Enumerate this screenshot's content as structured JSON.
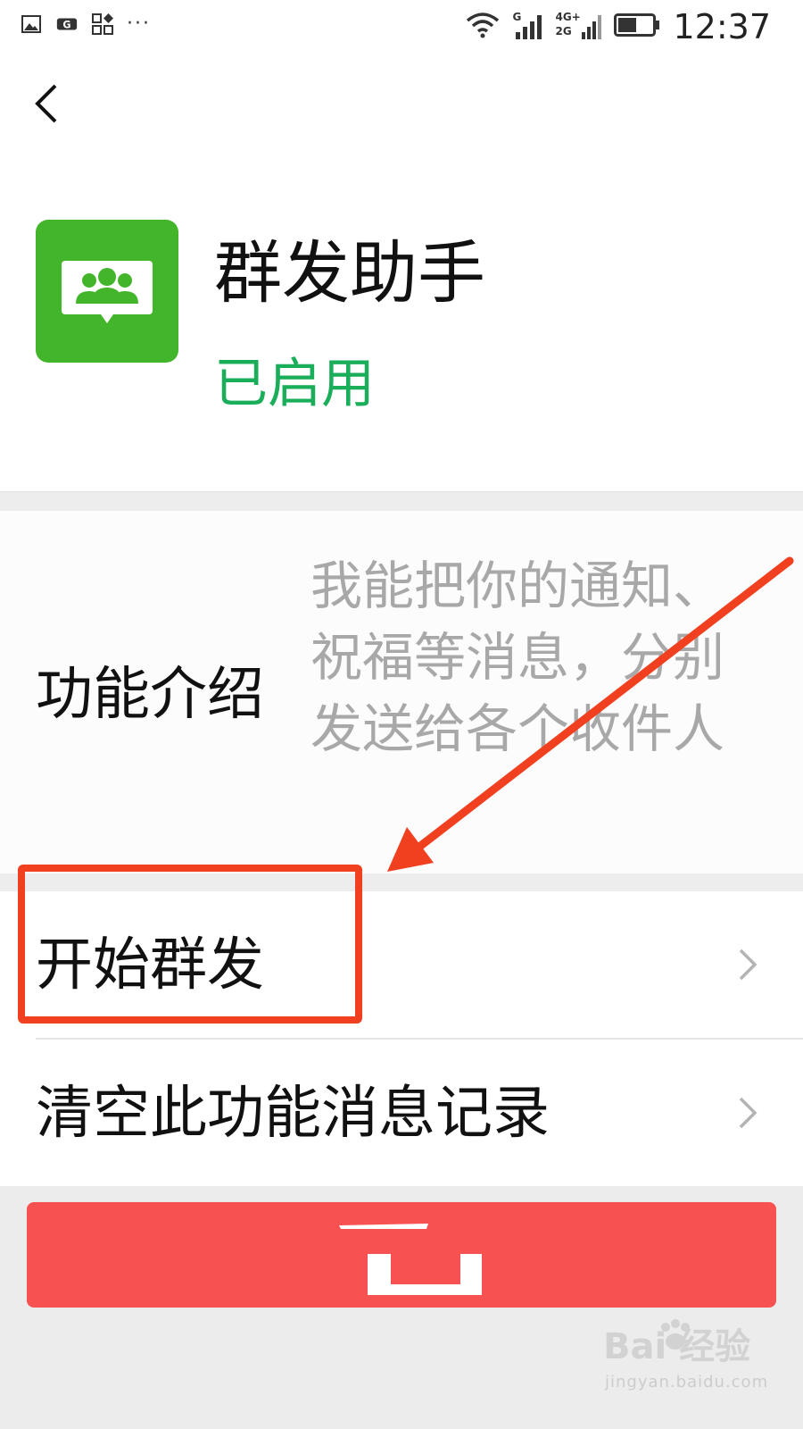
{
  "status_bar": {
    "time": "12:37",
    "network_top": "4G+",
    "network_bottom": "2G",
    "sim_label": "G",
    "overflow_dots": "···",
    "icons": [
      "image-icon",
      "notification-icon",
      "apps-icon",
      "wifi-icon",
      "signal-icon",
      "signal-icon-2",
      "battery-icon"
    ]
  },
  "nav": {
    "back_icon": "chevron-left-icon"
  },
  "header": {
    "title": "群发助手",
    "status": "已启用",
    "icon": "group-chat-icon"
  },
  "intro": {
    "label": "功能介绍",
    "description": "我能把你的通知、祝福等消息，分别发送给各个收件人"
  },
  "menu": {
    "items": [
      {
        "label": "开始群发",
        "icon": "chevron-right-icon"
      },
      {
        "label": "清空此功能消息记录",
        "icon": "chevron-right-icon"
      }
    ]
  },
  "bottom_button": {
    "label": "",
    "color": "#f75251"
  },
  "watermark": {
    "logo": "Bai 经验",
    "url": "jingyan.baidu.com"
  },
  "colors": {
    "accent_green": "#1aad5a",
    "icon_green": "#43b52a",
    "annotation_red": "#f0401f",
    "button_red": "#f75251"
  }
}
